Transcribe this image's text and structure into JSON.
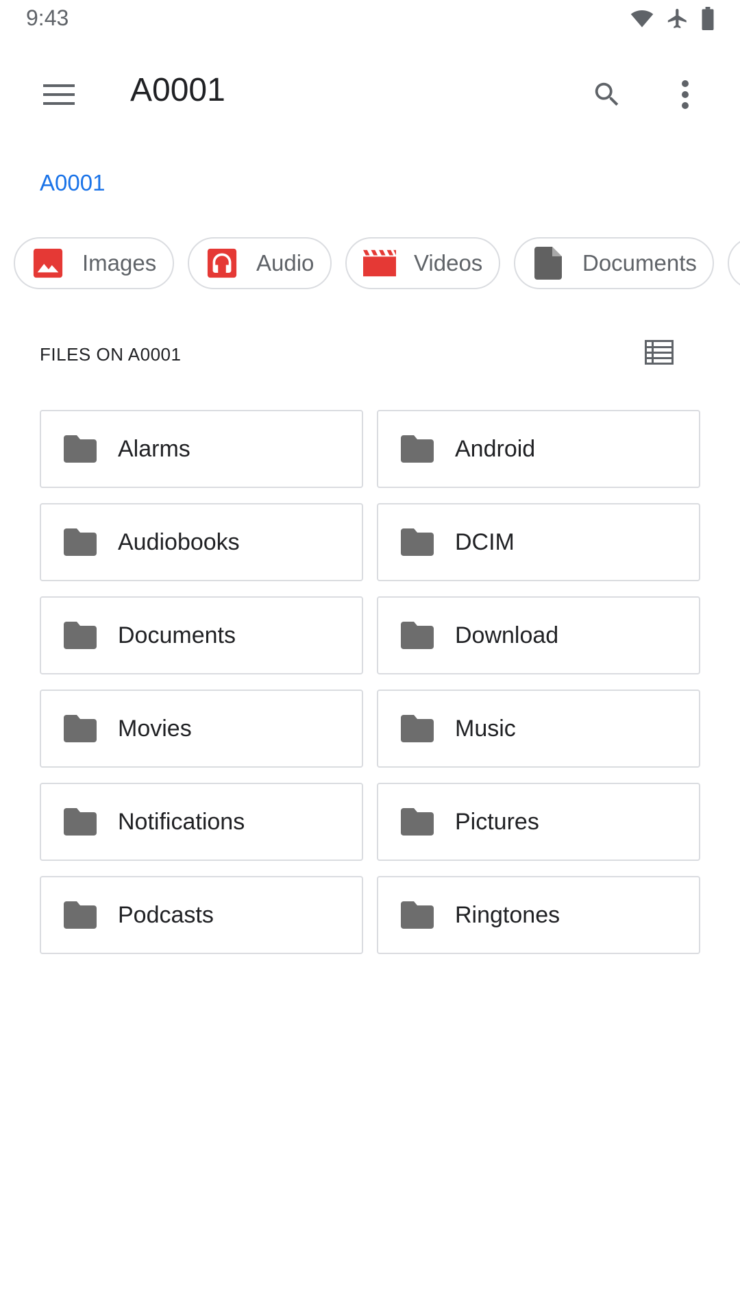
{
  "status_bar": {
    "time": "9:43",
    "icons": [
      "wifi-icon",
      "airplane-icon",
      "battery-icon"
    ]
  },
  "app_bar": {
    "title": "A0001",
    "icons": [
      "menu-icon",
      "search-icon",
      "more-vert-icon"
    ]
  },
  "breadcrumb": {
    "current": "A0001"
  },
  "chips": [
    {
      "label": "Images",
      "icon": "image-icon",
      "color": "#e53935"
    },
    {
      "label": "Audio",
      "icon": "headphones-icon",
      "color": "#e53935"
    },
    {
      "label": "Videos",
      "icon": "movie-icon",
      "color": "#e53935"
    },
    {
      "label": "Documents",
      "icon": "document-icon",
      "color": "#616161"
    }
  ],
  "section": {
    "title": "FILES ON A0001",
    "view_toggle_icon": "list-view-icon"
  },
  "folders": [
    {
      "label": "Alarms"
    },
    {
      "label": "Android"
    },
    {
      "label": "Audiobooks"
    },
    {
      "label": "DCIM"
    },
    {
      "label": "Documents"
    },
    {
      "label": "Download"
    },
    {
      "label": "Movies"
    },
    {
      "label": "Music"
    },
    {
      "label": "Notifications"
    },
    {
      "label": "Pictures"
    },
    {
      "label": "Podcasts"
    },
    {
      "label": "Ringtones"
    }
  ],
  "colors": {
    "accent": "#1a73e8",
    "icon_gray": "#5f6368",
    "folder_gray": "#6d6d6d",
    "border": "#dadce0"
  }
}
